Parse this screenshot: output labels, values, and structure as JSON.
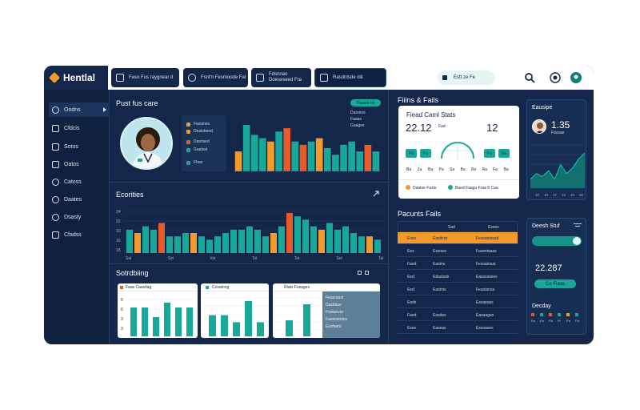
{
  "app": {
    "name": "Hentlal"
  },
  "tabs": [
    {
      "label": "Faso Fus raygnear d",
      "active": false
    },
    {
      "label": "Fsnt'n Fesmoode Fal",
      "active": false
    },
    {
      "label": "Fdsnnao Doeseseed Fra",
      "active": false
    },
    {
      "label": "Rasdntsde d&",
      "active": true
    }
  ],
  "search": {
    "text": "Estt ze Fe"
  },
  "sidebar": {
    "items": [
      {
        "label": "Oodns",
        "icon": "search-icon"
      },
      {
        "label": "Cfdcis",
        "icon": "people-icon"
      },
      {
        "label": "Sotos",
        "icon": "shield-icon"
      },
      {
        "label": "Oatos",
        "icon": "folder-icon"
      },
      {
        "label": "Catoss",
        "icon": "calendar-icon"
      },
      {
        "label": "Daates",
        "icon": "clock-icon"
      },
      {
        "label": "Dsasty",
        "icon": "gear-icon"
      },
      {
        "label": "Cfadss",
        "icon": "grid-icon"
      }
    ]
  },
  "patient": {
    "title": "Pust fus care",
    "legend": [
      {
        "label": "Fassines",
        "color": "#f39a2b"
      },
      {
        "label": "Dealsbeed",
        "color": "#f39a2b"
      },
      {
        "label": "Dasnsed",
        "color": "#e85a2a"
      },
      {
        "label": "Gaalsat",
        "color": "#17a899"
      },
      {
        "label": "Fhas",
        "color": "#17a899"
      }
    ],
    "chip": "Paaent fal",
    "chip_legend": [
      "Dasreos",
      "Faaas",
      "Gaages"
    ],
    "bars": [
      {
        "value": 6,
        "color": "#f39a2b"
      },
      {
        "value": 14,
        "color": "#17a899"
      },
      {
        "value": 11,
        "color": "#17a899"
      },
      {
        "value": 10,
        "color": "#17a899"
      },
      {
        "value": 9,
        "color": "#f39a2b"
      },
      {
        "value": 12,
        "color": "#17a899"
      },
      {
        "value": 13,
        "color": "#e85a2a"
      },
      {
        "value": 9,
        "color": "#17a899"
      },
      {
        "value": 8,
        "color": "#e85a2a"
      },
      {
        "value": 9,
        "color": "#17a899"
      },
      {
        "value": 10,
        "color": "#f39a2b"
      },
      {
        "value": 7,
        "color": "#17a899"
      },
      {
        "value": 5,
        "color": "#17a899"
      },
      {
        "value": 8,
        "color": "#17a899"
      },
      {
        "value": 9,
        "color": "#17a899"
      },
      {
        "value": 6,
        "color": "#17a899"
      },
      {
        "value": 8,
        "color": "#e85a2a"
      },
      {
        "value": 6,
        "color": "#17a899"
      }
    ]
  },
  "ecomities": {
    "title": "Ecorities",
    "x_ticks": [
      "Sal",
      "Sst",
      "Vat",
      "Tst",
      "Tat",
      "Set",
      "Tat"
    ],
    "y_ticks": [
      "24",
      "22",
      "10",
      "16",
      "18"
    ],
    "bars": [
      {
        "value": 7,
        "color": "#17a899"
      },
      {
        "value": 6,
        "color": "#f39a2b"
      },
      {
        "value": 8,
        "color": "#17a899"
      },
      {
        "value": 7,
        "color": "#17a899"
      },
      {
        "value": 9,
        "color": "#e85a2a"
      },
      {
        "value": 5,
        "color": "#17a899"
      },
      {
        "value": 5,
        "color": "#17a899"
      },
      {
        "value": 6,
        "color": "#17a899"
      },
      {
        "value": 6,
        "color": "#f39a2b"
      },
      {
        "value": 5,
        "color": "#17a899"
      },
      {
        "value": 4,
        "color": "#17a899"
      },
      {
        "value": 5,
        "color": "#17a899"
      },
      {
        "value": 6,
        "color": "#17a899"
      },
      {
        "value": 7,
        "color": "#17a899"
      },
      {
        "value": 7,
        "color": "#17a899"
      },
      {
        "value": 8,
        "color": "#17a899"
      },
      {
        "value": 7,
        "color": "#17a899"
      },
      {
        "value": 5,
        "color": "#17a899"
      },
      {
        "value": 6,
        "color": "#f39a2b"
      },
      {
        "value": 8,
        "color": "#17a899"
      },
      {
        "value": 12,
        "color": "#e85a2a"
      },
      {
        "value": 11,
        "color": "#17a899"
      },
      {
        "value": 10,
        "color": "#17a899"
      },
      {
        "value": 8,
        "color": "#17a899"
      },
      {
        "value": 7,
        "color": "#f39a2b"
      },
      {
        "value": 9,
        "color": "#17a899"
      },
      {
        "value": 7,
        "color": "#17a899"
      },
      {
        "value": 8,
        "color": "#17a899"
      },
      {
        "value": 6,
        "color": "#17a899"
      },
      {
        "value": 5,
        "color": "#17a899"
      },
      {
        "value": 5,
        "color": "#f39a2b"
      },
      {
        "value": 4,
        "color": "#17a899"
      }
    ]
  },
  "scheduling": {
    "title": "Sotrdbiing",
    "card1": {
      "title": "Faas Caastlag",
      "y_ticks": [
        "5",
        "6",
        "3",
        "3"
      ],
      "values": [
        6,
        6,
        4,
        7,
        6,
        6
      ]
    },
    "card2": {
      "title": "Cosatong",
      "values": [
        3,
        3,
        2,
        5,
        2
      ]
    },
    "card3": {
      "title": "Rlats Fosages",
      "values": [
        2,
        4
      ],
      "rows": [
        "Feasraast",
        "Dasbtsor",
        "Fostanvar",
        "Faessatotes",
        "Essfaant"
      ]
    }
  },
  "stats_card": {
    "section_title": "Fiiins & Fails",
    "title": "Fiead Caml Stats",
    "left_value": "22.12",
    "right_value": "12",
    "gauge_label": "Fad",
    "left_buttons": [
      "Fd",
      "Fa"
    ],
    "right_buttons": [
      "Fa",
      "Ga"
    ],
    "x_ticks": [
      "Ba",
      "Za",
      "Ba",
      "Pa",
      "Sa",
      "Ba",
      "Re",
      "Ra",
      "Fa",
      "Ba"
    ],
    "footer_left": "Daatse Fasts",
    "footer_right": "Baed Faagu Fraa 8 Caa"
  },
  "tracker": {
    "title": "Eausipe",
    "value": "1.35",
    "sub": "Fassae",
    "x_ticks": [
      "10",
      "10",
      "17",
      "12",
      "10",
      "30"
    ],
    "series": [
      3,
      5,
      4,
      6,
      3,
      8,
      5,
      7,
      10,
      12
    ]
  },
  "table": {
    "title": "Pacunts Fails",
    "headers": [
      "",
      "Sad",
      "Esses"
    ],
    "rows": [
      {
        "c1": "Eses",
        "c2": "Easdcat",
        "c3": "Fessastasad",
        "highlight": true
      },
      {
        "c1": "Ees",
        "c2": "Essisss",
        "c3": "Fasestaass",
        "highlight": false
      },
      {
        "c1": "Faed",
        "c2": "Eastns",
        "c3": "Fessatoast",
        "highlight": false
      },
      {
        "c1": "Eed",
        "c2": "Edasisds",
        "c3": "Easssssees",
        "highlight": false
      },
      {
        "c1": "Eed",
        "c2": "Eastnts",
        "c3": "Feastanss",
        "highlight": false
      },
      {
        "c1": "Eeds",
        "c2": "",
        "c3": "Essaeass",
        "highlight": false
      },
      {
        "c1": "Faed",
        "c2": "Easdes",
        "c3": "Easaages",
        "highlight": false
      },
      {
        "c1": "Eses",
        "c2": "Easeas",
        "c3": "Essoases",
        "highlight": false
      }
    ]
  },
  "dash_stats": {
    "title": "Deesh Stuf",
    "value": "22.287",
    "btn": "Co Fiaas",
    "footer_title": "Decday",
    "footer_labels": [
      "Fa",
      "Fa",
      "Fa",
      "Fr",
      "Fa",
      "Fa"
    ]
  }
}
